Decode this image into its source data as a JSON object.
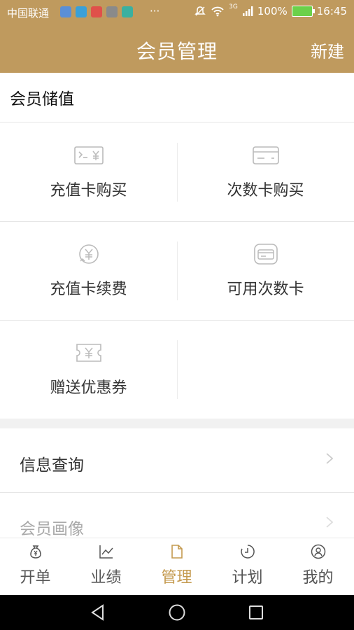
{
  "status_bar": {
    "carrier": "中国联通",
    "dots": "···",
    "signal": "3G",
    "battery": "100%",
    "time": "16:45",
    "colors": {
      "bar": "#bf9a5e"
    }
  },
  "app_bar": {
    "title": "会员管理",
    "new_label": "新建"
  },
  "member_storage": {
    "section_title": "会员储值",
    "grid": [
      {
        "label": "充值卡购买",
        "icon": "card-yen-icon"
      },
      {
        "label": "次数卡购买",
        "icon": "credit-card-icon"
      },
      {
        "label": "充值卡续费",
        "icon": "yen-refresh-icon"
      },
      {
        "label": "可用次数卡",
        "icon": "card-wallet-icon"
      },
      {
        "label": "赠送优惠券",
        "icon": "coupon-yen-icon"
      }
    ]
  },
  "list": [
    {
      "label": "信息查询"
    },
    {
      "label": "会员画像"
    }
  ],
  "tab_bar": {
    "tabs": [
      {
        "label": "开单",
        "icon": "money-bag-icon"
      },
      {
        "label": "业绩",
        "icon": "line-chart-icon"
      },
      {
        "label": "管理",
        "icon": "document-icon",
        "active": true
      },
      {
        "label": "计划",
        "icon": "clock-icon"
      },
      {
        "label": "我的",
        "icon": "user-icon"
      }
    ],
    "colors": {
      "active": "#c49a4f",
      "inactive": "#555555"
    }
  },
  "nav_bar": {
    "buttons": [
      "back-icon",
      "home-icon",
      "recents-icon"
    ]
  }
}
